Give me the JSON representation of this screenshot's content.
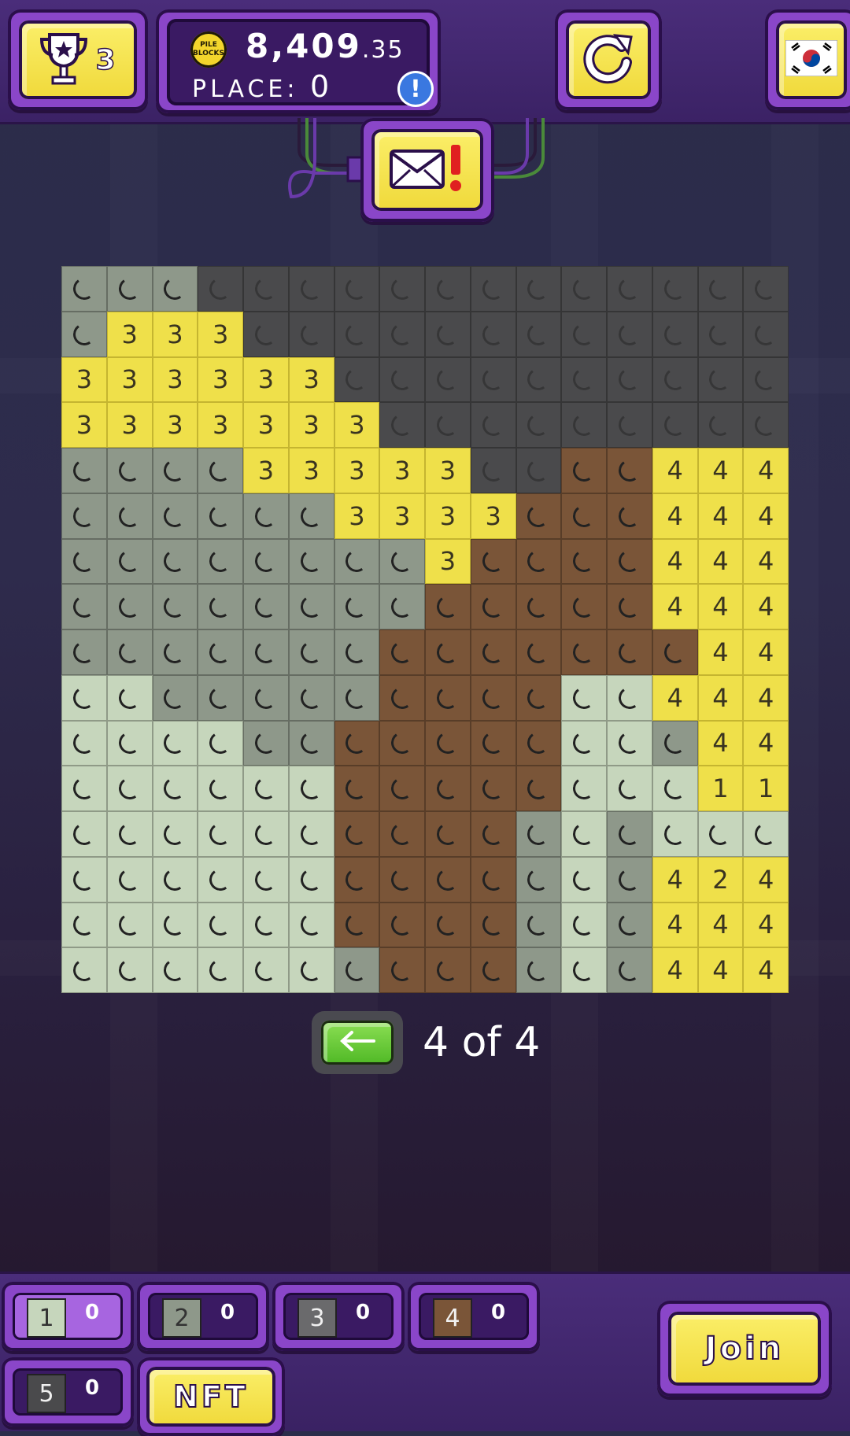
{
  "header": {
    "trophy_count": "3",
    "coin_label": "PILE BLOCKS",
    "balance_main": "8,409",
    "balance_decimal": ".35",
    "place_label": "PLACE:",
    "place_value": "0",
    "info_symbol": "!"
  },
  "icons": {
    "trophy": "trophy-icon",
    "refresh": "refresh-icon",
    "flag": "south-korea-flag-icon",
    "mail": "mail-alert-icon",
    "back": "back-arrow-icon"
  },
  "colors": {
    "yellow": "#efe04a",
    "light_green": "#c6d6bc",
    "gray_green": "#8e988a",
    "dark_gray": "#4a4a4c",
    "brown": "#7a5538",
    "mid_gray": "#5a5a5c"
  },
  "grid": {
    "rows": [
      [
        "g",
        "g",
        "g",
        "d",
        "d",
        "d",
        "d",
        "d",
        "d",
        "d",
        "d",
        "d",
        "d",
        "d",
        "d",
        "d"
      ],
      [
        "g",
        "3",
        "3",
        "3",
        "d",
        "d",
        "d",
        "d",
        "d",
        "d",
        "d",
        "d",
        "d",
        "d",
        "d",
        "d"
      ],
      [
        "3",
        "3",
        "3",
        "3",
        "3",
        "3",
        "d",
        "d",
        "d",
        "d",
        "d",
        "d",
        "d",
        "d",
        "d",
        "d"
      ],
      [
        "3",
        "3",
        "3",
        "3",
        "3",
        "3",
        "3",
        "d",
        "d",
        "d",
        "d",
        "d",
        "d",
        "d",
        "d",
        "d"
      ],
      [
        "g",
        "g",
        "g",
        "g",
        "3",
        "3",
        "3",
        "3",
        "3",
        "d",
        "d",
        "b",
        "b",
        "4",
        "4",
        "4"
      ],
      [
        "g",
        "g",
        "g",
        "g",
        "g",
        "g",
        "3",
        "3",
        "3",
        "3",
        "b",
        "b",
        "b",
        "4",
        "4",
        "4"
      ],
      [
        "g",
        "g",
        "g",
        "g",
        "g",
        "g",
        "g",
        "g",
        "3",
        "b",
        "b",
        "b",
        "b",
        "4",
        "4",
        "4"
      ],
      [
        "g",
        "g",
        "g",
        "g",
        "g",
        "g",
        "g",
        "g",
        "b",
        "b",
        "b",
        "b",
        "b",
        "4",
        "4",
        "4"
      ],
      [
        "g",
        "g",
        "g",
        "g",
        "g",
        "g",
        "g",
        "b",
        "b",
        "b",
        "b",
        "b",
        "b",
        "b",
        "4",
        "4"
      ],
      [
        "l",
        "l",
        "g",
        "g",
        "g",
        "g",
        "g",
        "b",
        "b",
        "b",
        "b",
        "l",
        "l",
        "4",
        "4",
        "4"
      ],
      [
        "l",
        "l",
        "l",
        "l",
        "g",
        "g",
        "b",
        "b",
        "b",
        "b",
        "b",
        "l",
        "l",
        "g",
        "4",
        "4"
      ],
      [
        "l",
        "l",
        "l",
        "l",
        "l",
        "l",
        "b",
        "b",
        "b",
        "b",
        "b",
        "l",
        "l",
        "l",
        "1",
        "1"
      ],
      [
        "l",
        "l",
        "l",
        "l",
        "l",
        "l",
        "b",
        "b",
        "b",
        "b",
        "g",
        "l",
        "g",
        "l",
        "l",
        "l"
      ],
      [
        "l",
        "l",
        "l",
        "l",
        "l",
        "l",
        "b",
        "b",
        "b",
        "b",
        "g",
        "l",
        "g",
        "4",
        "2",
        "4"
      ],
      [
        "l",
        "l",
        "l",
        "l",
        "l",
        "l",
        "b",
        "b",
        "b",
        "b",
        "g",
        "l",
        "g",
        "4",
        "4",
        "4"
      ],
      [
        "l",
        "l",
        "l",
        "l",
        "l",
        "l",
        "g",
        "b",
        "b",
        "b",
        "g",
        "l",
        "g",
        "4",
        "4",
        "4"
      ]
    ]
  },
  "pager": {
    "text": "4 of 4"
  },
  "palette": [
    {
      "number": "1",
      "count": "0",
      "color": "#c6d6bc"
    },
    {
      "number": "2",
      "count": "0",
      "color": "#8e988a"
    },
    {
      "number": "3",
      "count": "0",
      "color": "#6a6a6c"
    },
    {
      "number": "4",
      "count": "0",
      "color": "#7a5538"
    },
    {
      "number": "5",
      "count": "0",
      "color": "#4a4a4c"
    }
  ],
  "buttons": {
    "nft": "NFT",
    "join": "Join"
  }
}
